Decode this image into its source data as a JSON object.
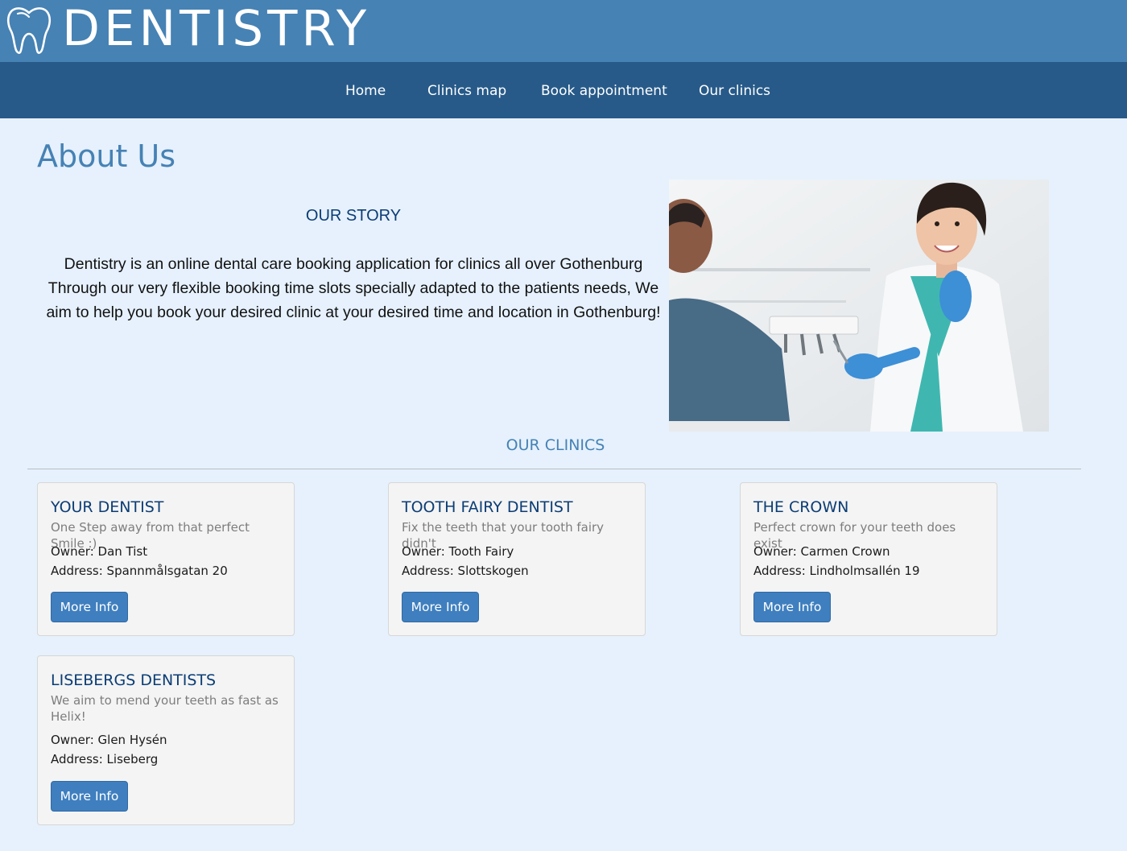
{
  "header": {
    "logo_text": "DENTISTRY",
    "logo_icon": "tooth-icon"
  },
  "nav": {
    "items": [
      "Home",
      "Clinics map",
      "Book appointment",
      "Our clinics"
    ]
  },
  "page": {
    "title": "About Us"
  },
  "story": {
    "heading": "OUR STORY",
    "text": "Dentistry is an online dental care booking application for clinics all over Gothenburg Through our very flexible booking time slots specially adapted to the patients needs, We aim to help you book your desired clinic at your desired time and location in Gothenburg!"
  },
  "clinics": {
    "heading": "OUR CLINICS",
    "cards": [
      {
        "title": "YOUR DENTIST",
        "tagline": "One Step away from that perfect Smile :)",
        "owner": "Owner: Dan Tist",
        "address": "Address: Spannmålsgatan 20",
        "button": "More Info"
      },
      {
        "title": "TOOTH FAIRY DENTIST",
        "tagline": "Fix the teeth that your tooth fairy didn't",
        "owner": "Owner: Tooth Fairy",
        "address": "Address: Slottskogen",
        "button": "More Info"
      },
      {
        "title": "THE CROWN",
        "tagline": "Perfect crown for your teeth does exist",
        "owner": "Owner: Carmen Crown",
        "address": "Address: Lindholmsallén 19",
        "button": "More Info"
      },
      {
        "title": "LISEBERGS DENTISTS",
        "tagline": "We aim to mend your teeth as fast as Helix!",
        "owner": "Owner: Glen Hysén",
        "address": "Address: Liseberg",
        "button": "More Info"
      }
    ]
  },
  "colors": {
    "header_bg": "#4682b4",
    "nav_bg": "#275a89",
    "page_bg": "#e6f1fd",
    "accent": "#4682b4",
    "title_dark": "#0b3d75",
    "button_bg": "#3f7fbf"
  }
}
